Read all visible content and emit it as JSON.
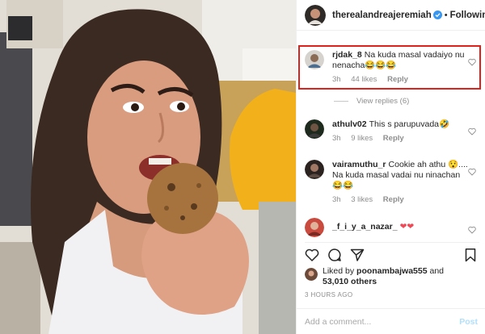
{
  "post": {
    "author": "therealandreajeremiah",
    "separator": "•",
    "follow_label": "Following"
  },
  "comments": [
    {
      "username": "rjdak_8",
      "text": "Na kuda masal vadaiyo nu nenacha😂😂😂",
      "time": "3h",
      "likes": "44 likes",
      "reply": "Reply",
      "view_replies": "View replies (6)"
    },
    {
      "username": "athulv02",
      "text": "This s parupuvada🤣",
      "time": "3h",
      "likes": "9 likes",
      "reply": "Reply"
    },
    {
      "username": "vairamuthu_r",
      "text": "Cookie ah athu 😯.... Na kuda masal vadai nu ninachan😂😂",
      "time": "3h",
      "likes": "3 likes",
      "reply": "Reply"
    },
    {
      "username": "_f_i_y_a_nazar_",
      "text": "❤❤"
    }
  ],
  "likes_summary": {
    "prefix": "Liked by",
    "user": "poonambajwa555",
    "connector": "and",
    "count": "53,010 others"
  },
  "date": "3 HOURS AGO",
  "composer": {
    "placeholder": "Add a comment...",
    "post_label": "Post"
  },
  "icons": [
    "verified-badge-icon",
    "heart-icon",
    "comment-icon",
    "share-icon",
    "bookmark-icon"
  ],
  "colors": {
    "accent": "#3897f0",
    "highlight": "#e0201a",
    "muted": "#8e8e8e",
    "post_disabled": "#b2dffc"
  }
}
